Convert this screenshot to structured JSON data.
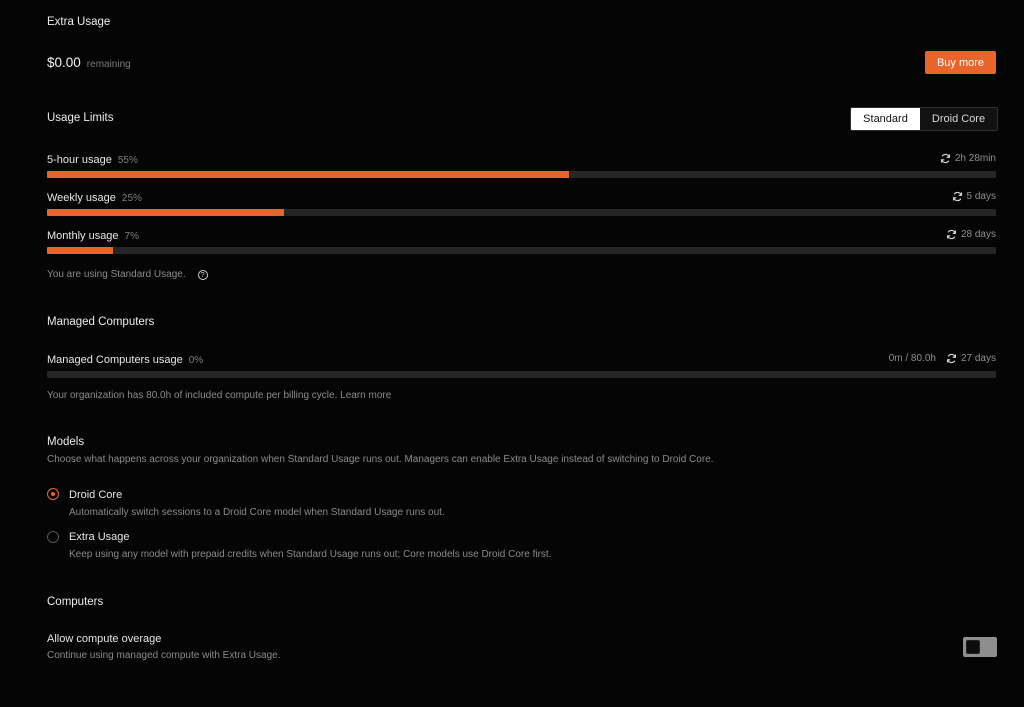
{
  "extra_usage": {
    "heading": "Extra Usage",
    "amount": "$0.00",
    "amount_suffix": "remaining",
    "buy_label": "Buy more"
  },
  "usage_limits": {
    "heading": "Usage Limits",
    "tabs": [
      "Standard",
      "Droid Core"
    ],
    "active_tab": "Standard",
    "bars": [
      {
        "label": "5-hour usage",
        "percent_text": "55%",
        "value": 0.55,
        "reset": "2h 28min"
      },
      {
        "label": "Weekly usage",
        "percent_text": "25%",
        "value": 0.25,
        "reset": "5 days"
      },
      {
        "label": "Monthly usage",
        "percent_text": "7%",
        "value": 0.07,
        "reset": "28 days"
      }
    ],
    "note": "You are using Standard Usage.",
    "help_glyph": "?"
  },
  "managed_computers": {
    "heading": "Managed Computers",
    "label": "Managed Computers usage",
    "percent_text": "0%",
    "value": 0.0,
    "amount": "0m / 80.0h",
    "reset": "27 days",
    "note": "Your organization has 80.0h of included compute per billing cycle. Learn more"
  },
  "models": {
    "heading": "Models",
    "description": "Choose what happens across your organization when Standard Usage runs out. Managers can enable Extra Usage instead of switching to Droid Core.",
    "options": [
      {
        "title": "Droid Core",
        "desc": "Automatically switch sessions to a Droid Core model when Standard Usage runs out.",
        "selected": true
      },
      {
        "title": "Extra Usage",
        "desc": "Keep using any model with prepaid credits when Standard Usage runs out; Core models use Droid Core first.",
        "selected": false
      }
    ]
  },
  "computers": {
    "heading": "Computers",
    "overage_title": "Allow compute overage",
    "overage_desc": "Continue using managed compute with Extra Usage.",
    "overage_enabled": false
  },
  "colors": {
    "accent": "#e5652e",
    "background": "#050505",
    "track": "#262626"
  }
}
